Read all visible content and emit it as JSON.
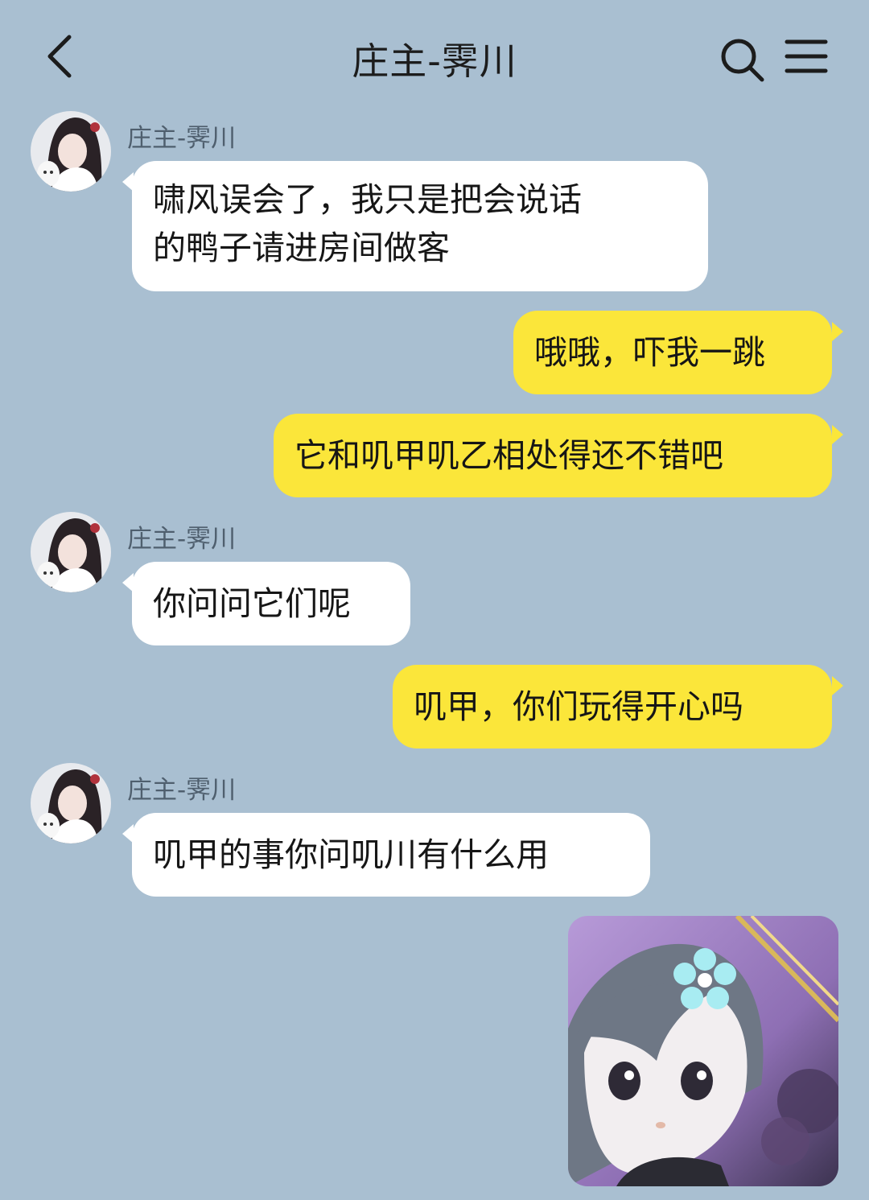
{
  "header": {
    "title": "庄主-霁川",
    "back_icon": "chevron-left-icon",
    "search_icon": "search-icon",
    "menu_icon": "menu-icon"
  },
  "colors": {
    "background": "#a9bfd1",
    "incoming_bubble": "#ffffff",
    "outgoing_bubble": "#fbe63a"
  },
  "messages": [
    {
      "side": "in",
      "sender": "庄主-霁川",
      "text_lines": [
        "啸风误会了，我只是把会说话",
        "的鸭子请进房间做客"
      ]
    },
    {
      "side": "out",
      "text": "哦哦，吓我一跳"
    },
    {
      "side": "out",
      "text": "它和叽甲叽乙相处得还不错吧"
    },
    {
      "side": "in",
      "sender": "庄主-霁川",
      "text": "你问问它们呢"
    },
    {
      "side": "out",
      "text": "叽甲，你们玩得开心吗"
    },
    {
      "side": "in",
      "sender": "庄主-霁川",
      "text": "叽甲的事你问叽川有什么用"
    },
    {
      "side": "out",
      "type": "sticker",
      "icon": "chibi-character-sticker"
    }
  ]
}
